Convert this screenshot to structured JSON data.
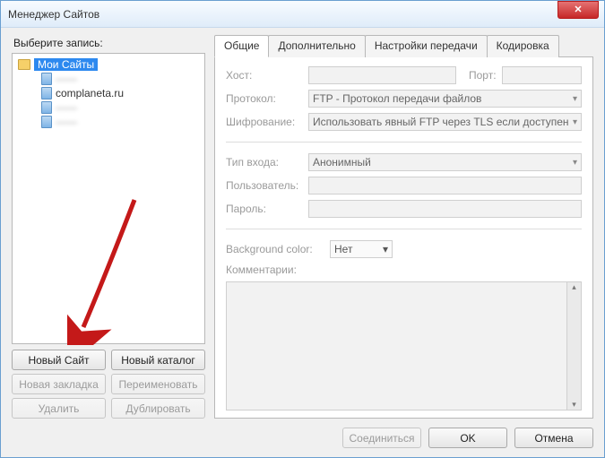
{
  "window": {
    "title": "Менеджер Сайтов"
  },
  "left": {
    "label": "Выберите запись:",
    "root": "Мои Сайты",
    "sites": [
      {
        "name": "——"
      },
      {
        "name": "complaneta.ru"
      },
      {
        "name": "——"
      },
      {
        "name": "——"
      }
    ],
    "buttons": {
      "new_site": "Новый Сайт",
      "new_folder": "Новый каталог",
      "new_bookmark": "Новая закладка",
      "rename": "Переименовать",
      "delete": "Удалить",
      "duplicate": "Дублировать"
    }
  },
  "tabs": {
    "general": "Общие",
    "advanced": "Дополнительно",
    "transfer": "Настройки передачи",
    "charset": "Кодировка"
  },
  "form": {
    "host_label": "Хост:",
    "port_label": "Порт:",
    "protocol_label": "Протокол:",
    "protocol_value": "FTP - Протокол передачи файлов",
    "encryption_label": "Шифрование:",
    "encryption_value": "Использовать явный FTP через TLS если доступен",
    "logon_label": "Тип входа:",
    "logon_value": "Анонимный",
    "user_label": "Пользователь:",
    "password_label": "Пароль:",
    "bgcolor_label": "Background color:",
    "bgcolor_value": "Нет",
    "comments_label": "Комментарии:"
  },
  "footer": {
    "connect": "Соединиться",
    "ok": "OK",
    "cancel": "Отмена"
  }
}
